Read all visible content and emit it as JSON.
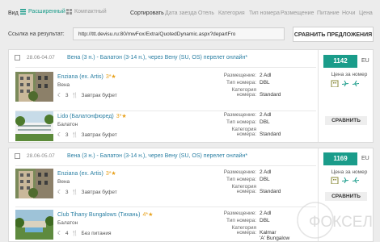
{
  "view": {
    "label": "Вид",
    "extended": "Расширенный",
    "compact": "Компактный"
  },
  "sort": {
    "label": "Сортировать",
    "items": [
      "Дата заезда",
      "Отель",
      "Категория",
      "Тип номера",
      "Размещение",
      "Питание",
      "Ночи",
      "Цена"
    ]
  },
  "link": {
    "label": "Ссылка на результат:",
    "url": "http://ttt.devisu.ru:80/mwFox/Extra/QuotedDynamic.aspx?departFro"
  },
  "compare_all": "СРАВНИТЬ ПРЕДЛОЖЕНИЯ",
  "offers": [
    {
      "date": "28.06-04.07",
      "route": "Вена (3 н.) - Балатон (3-14 н.), через Вену (SU, OS) перелет онлайн*",
      "price": "1142",
      "currency": "EU",
      "per_room": "Цена за номер",
      "compare": "СРАВНИТЬ",
      "hotels": [
        {
          "name": "Enziana (ex. Artis)",
          "stars": "3*★",
          "city": "Вена",
          "nights": "3",
          "meal": "Завтрак буфет",
          "accommodation_label": "Размещение:",
          "accommodation": "2 Adl",
          "room_type_label": "Тип номера:",
          "room_type": "DBL",
          "category_label1": "Категория",
          "category_label2": "номера:",
          "category": "Standard"
        },
        {
          "name": "Lido (Балатонфюред)",
          "stars": "3*★",
          "city": "Балатон",
          "nights": "3",
          "meal": "Завтрак буфет",
          "accommodation_label": "Размещение:",
          "accommodation": "2 Adl",
          "room_type_label": "Тип номера:",
          "room_type": "DBL",
          "category_label1": "Категория",
          "category_label2": "номера:",
          "category": "Standard"
        }
      ]
    },
    {
      "date": "28.06-05.07",
      "route": "Вена (3 н.) - Балатон (3-14 н.), через Вену (SU, OS) перелет онлайн*",
      "price": "1169",
      "currency": "EU",
      "per_room": "Цена за номер",
      "compare": "СРАВНИТЬ",
      "hotels": [
        {
          "name": "Enziana (ex. Artis)",
          "stars": "3*★",
          "city": "Вена",
          "nights": "3",
          "meal": "Завтрак буфет",
          "accommodation_label": "Размещение:",
          "accommodation": "2 Adl",
          "room_type_label": "Тип номера:",
          "room_type": "DBL",
          "category_label1": "Категория",
          "category_label2": "номера:",
          "category": "Standard"
        },
        {
          "name": "Club Tihany Bungalows (Тихань)",
          "stars": "4*★",
          "city": "Балатон",
          "nights": "4",
          "meal": "Без питания",
          "accommodation_label": "Размещение:",
          "accommodation": "2 Adl",
          "room_type_label": "Тип номера:",
          "room_type": "DBL",
          "category_label1": "Категория",
          "category_label2": "номера:",
          "category": "Kalmar",
          "category_line2": "'A' Bungalow"
        }
      ]
    }
  ],
  "watermark": "ФОКСЕЛ",
  "colors": {
    "accent": "#1a9c8a",
    "link": "#2a7fa3",
    "star": "#e8a21e"
  }
}
